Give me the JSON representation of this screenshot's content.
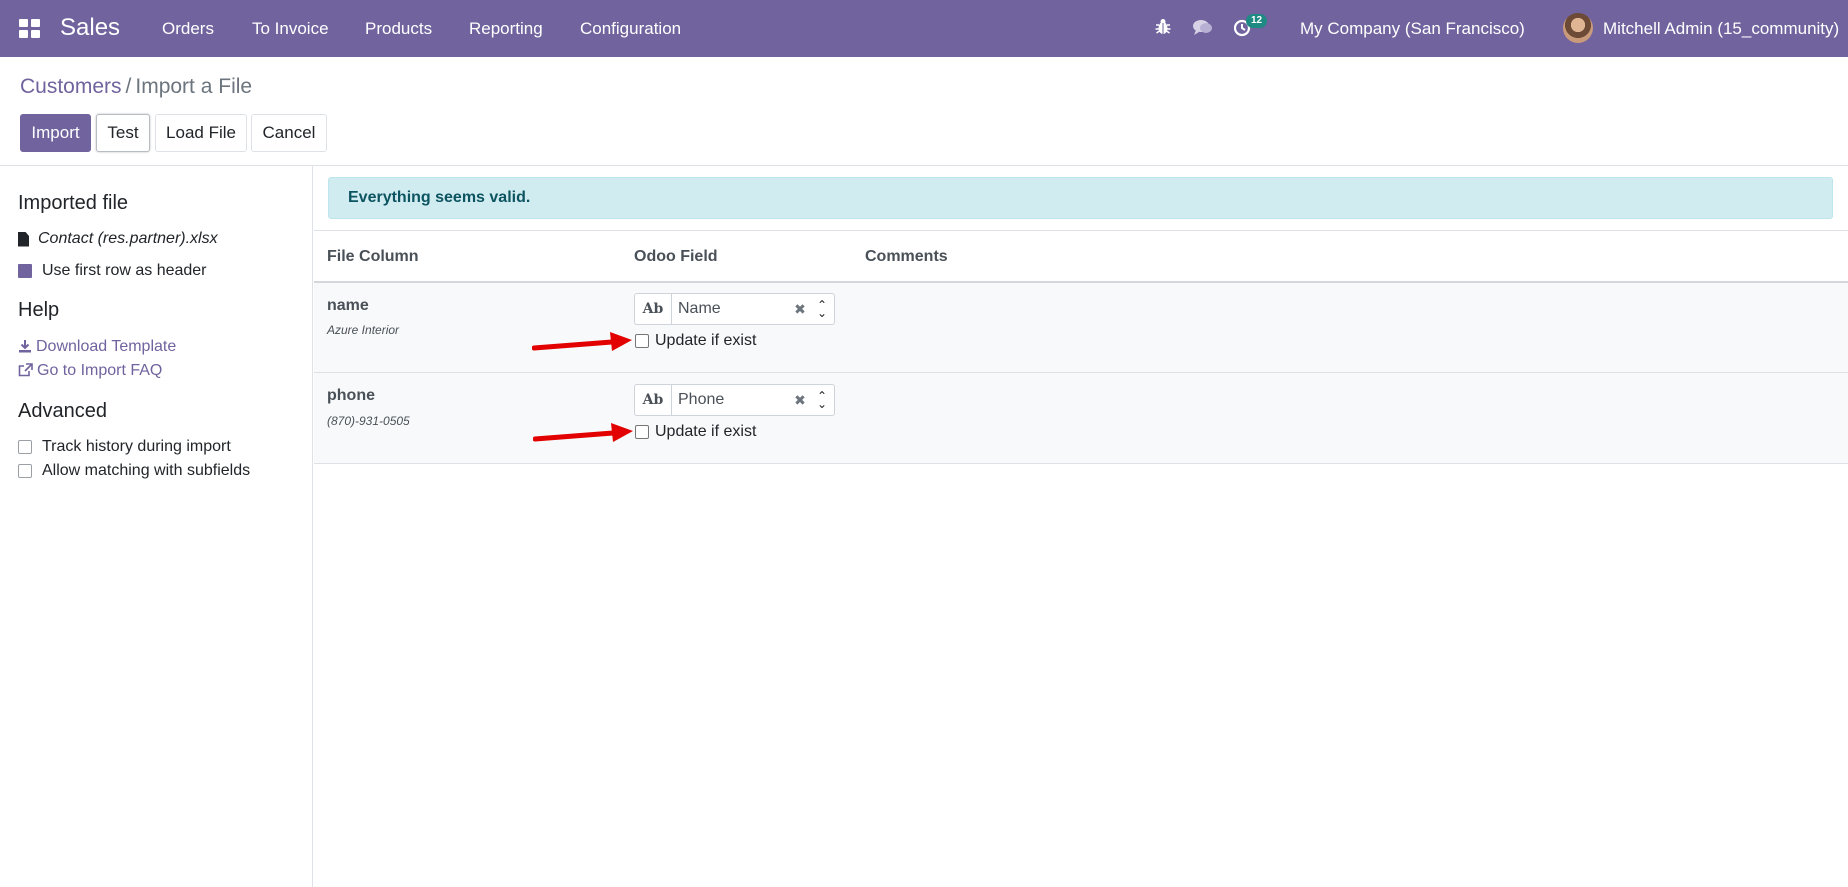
{
  "navbar": {
    "brand": "Sales",
    "menu": [
      "Orders",
      "To Invoice",
      "Products",
      "Reporting",
      "Configuration"
    ],
    "activity_count": "12",
    "company": "My Company (San Francisco)",
    "user": "Mitchell Admin (15_community)",
    "bg_color": "#71639e"
  },
  "breadcrumb": {
    "parent": "Customers",
    "separator": "/",
    "current": "Import a File"
  },
  "buttons": {
    "import": "Import",
    "test": "Test",
    "load_file": "Load File",
    "cancel": "Cancel"
  },
  "sidebar": {
    "imported_file_heading": "Imported file",
    "filename": "Contact (res.partner).xlsx",
    "use_header_label": "Use first row as header",
    "use_header_checked": true,
    "help_heading": "Help",
    "download_template": "Download Template",
    "import_faq": "Go to Import FAQ",
    "advanced_heading": "Advanced",
    "track_history": "Track history during import",
    "track_history_checked": false,
    "allow_subfields": "Allow matching with subfields",
    "allow_subfields_checked": false
  },
  "alert": {
    "message": "Everything seems valid.",
    "color": "#d1ecf1"
  },
  "table": {
    "headers": {
      "file_column": "File Column",
      "odoo_field": "Odoo Field",
      "comments": "Comments"
    },
    "rows": [
      {
        "column": "name",
        "sample": "Azure Interior",
        "field_type": "Ab",
        "field": "Name",
        "update_label": "Update if exist",
        "update_checked": false
      },
      {
        "column": "phone",
        "sample": "(870)-931-0505",
        "field_type": "Ab",
        "field": "Phone",
        "update_label": "Update if exist",
        "update_checked": false
      }
    ]
  }
}
